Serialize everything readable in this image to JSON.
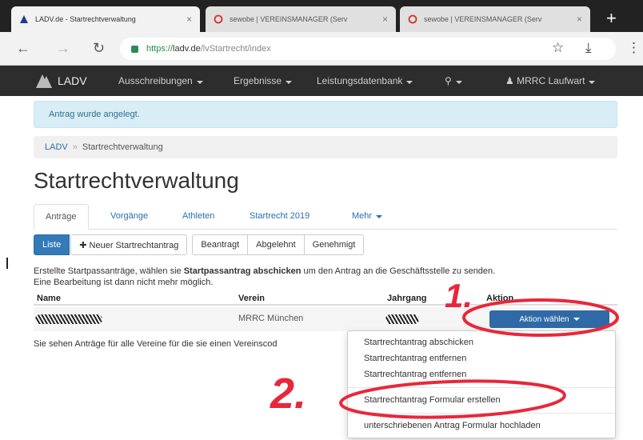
{
  "browser": {
    "tabs": [
      {
        "title": "LADV.de - Startrechtverwaltung",
        "active": true
      },
      {
        "title": "sewobe | VEREINSMANAGER (Serv",
        "active": false
      },
      {
        "title": "sewobe | VEREINSMANAGER (Serv",
        "active": false
      }
    ],
    "new_tab": "+",
    "close_glyph": "×",
    "url_scheme": "https://",
    "url_host": "ladv.de",
    "url_path": "/lvStartrecht/index"
  },
  "site_nav": {
    "brand": "LADV",
    "items": [
      "Ausschreibungen",
      "Ergebnisse",
      "Leistungsdatenbank"
    ],
    "user": "MRRC Laufwart"
  },
  "alert": {
    "text": "Antrag wurde angelegt."
  },
  "breadcrumb": {
    "home": "LADV",
    "separator": "»",
    "current": "Startrechtverwaltung"
  },
  "page_title": "Startrechtverwaltung",
  "tabs": [
    "Anträge",
    "Vorgänge",
    "Athleten",
    "Startrecht 2019",
    "Mehr"
  ],
  "buttons": {
    "liste": "Liste",
    "neuer": "Neuer Startrechtantrag",
    "filters": [
      "Beantragt",
      "Abgelehnt",
      "Genehmigt"
    ]
  },
  "info": {
    "before": "Erstellte Startpassanträge, wählen sie ",
    "bold": "Startpassantrag abschicken",
    "after": " um den Antrag an die Geschäftsstelle zu senden.",
    "line2": "Eine Bearbeitung ist dann nicht mehr möglich."
  },
  "table": {
    "headers": [
      "Name",
      "Verein",
      "Jahrgang",
      "Aktion"
    ],
    "rows": [
      {
        "verein": "MRRC München",
        "action": "Aktion wählen"
      }
    ]
  },
  "footer_note": "Sie sehen Anträge für alle Vereine für die sie einen Vereinscod",
  "dropdown": [
    "Startrechtantrag abschicken",
    "Startrechtantrag entfernen",
    "Startrechtantrag entfernen",
    "Startrechtantrag Formular erstellen",
    "unterschriebenen Antrag Formular hochladen"
  ],
  "annotations": {
    "one": "1.",
    "two": "2."
  },
  "colors": {
    "annotation": "#e8273b",
    "primary": "#337ab7",
    "navbar": "#2d2d2d",
    "alert_bg": "#d9edf7"
  }
}
